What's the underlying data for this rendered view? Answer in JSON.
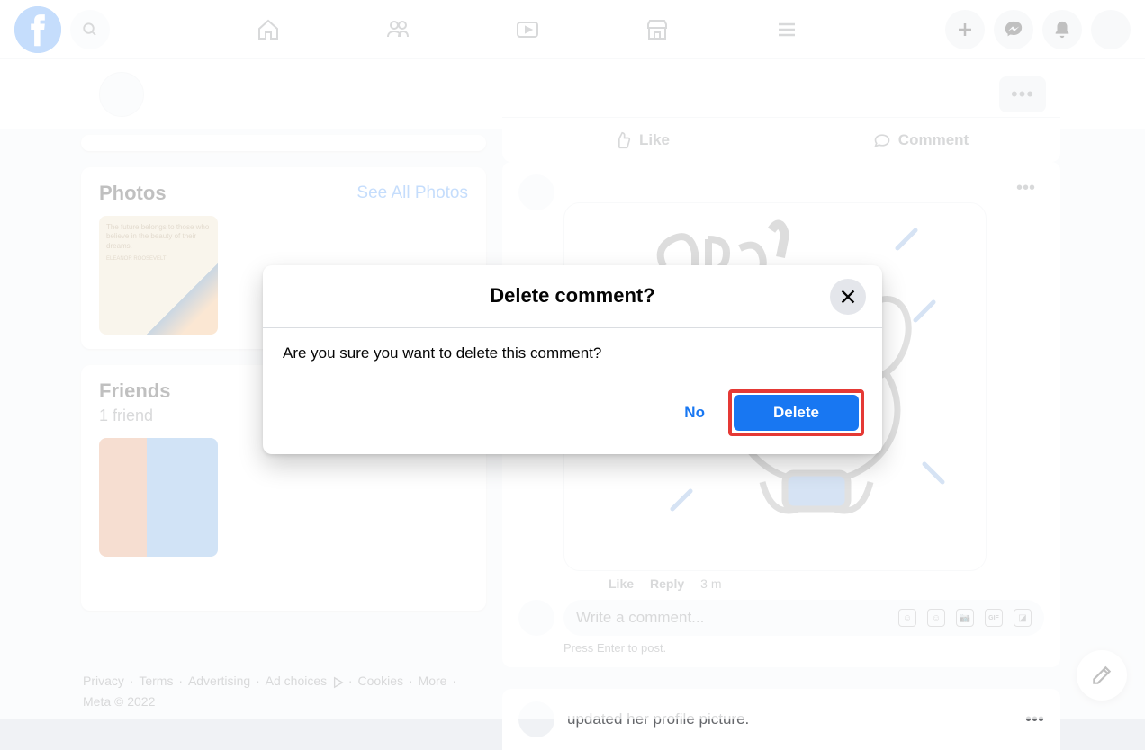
{
  "topbar": {
    "nav": {
      "home": "Home",
      "friends": "Friends",
      "watch": "Watch",
      "marketplace": "Marketplace",
      "menu": "Menu"
    },
    "actions": {
      "create": "Create",
      "messenger": "Messenger",
      "notifications": "Notifications"
    }
  },
  "sidebar": {
    "photos": {
      "title": "Photos",
      "link": "See All Photos",
      "quote": "The future belongs to those who believe in the beauty of their dreams.",
      "author": "ELEANOR ROOSEVELT"
    },
    "friends": {
      "title": "Friends",
      "count": "1 friend"
    }
  },
  "post": {
    "like_label": "Like",
    "comment_label": "Comment",
    "comment_actions": {
      "like": "Like",
      "reply": "Reply",
      "time": "3 m"
    },
    "input_placeholder": "Write a comment...",
    "enter_hint": "Press Enter to post.",
    "next_post_text": "updated her profile picture."
  },
  "modal": {
    "title": "Delete comment?",
    "body": "Are you sure you want to delete this comment?",
    "no_label": "No",
    "delete_label": "Delete"
  },
  "footer": {
    "links": [
      "Privacy",
      "Terms",
      "Advertising",
      "Ad choices",
      "Cookies",
      "More"
    ],
    "copyright": "Meta © 2022"
  }
}
